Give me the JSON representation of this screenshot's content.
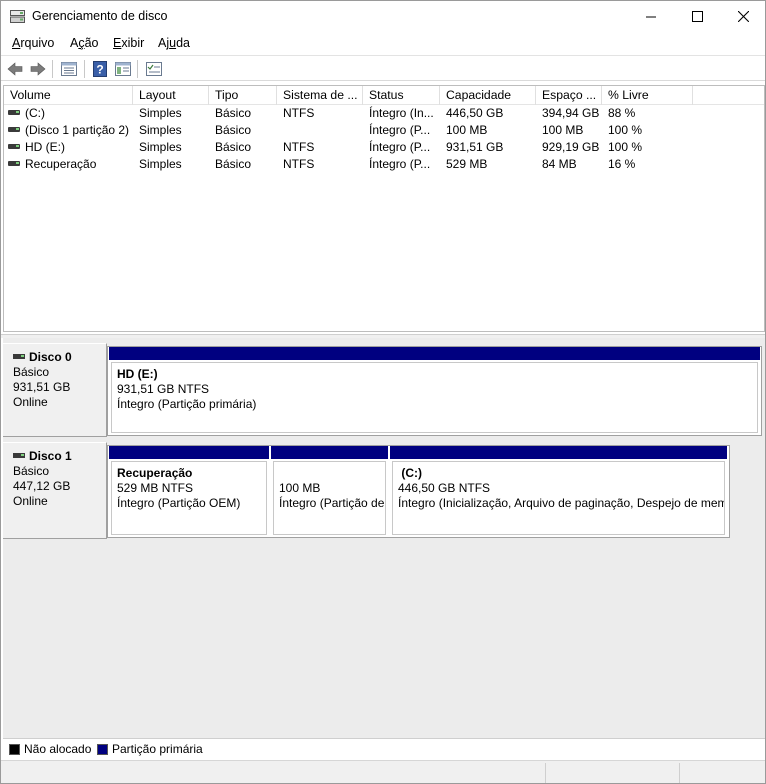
{
  "window": {
    "title": "Gerenciamento de disco",
    "controls": [
      "minimize-icon",
      "maximize-icon",
      "close-icon"
    ]
  },
  "menu": [
    {
      "label_pre": "",
      "accel": "A",
      "label_post": "rquivo"
    },
    {
      "label_pre": "A",
      "accel": "ç",
      "label_post": "ão"
    },
    {
      "label_pre": "",
      "accel": "E",
      "label_post": "xibir"
    },
    {
      "label_pre": "Aj",
      "accel": "u",
      "label_post": "da"
    }
  ],
  "toolbar": {
    "buttons": [
      "back-arrow-icon",
      "forward-arrow-icon",
      "list-view-icon",
      "help-icon",
      "console-tree-icon",
      "properties-icon"
    ]
  },
  "volume_list": {
    "columns": [
      "Volume",
      "Layout",
      "Tipo",
      "Sistema de ...",
      "Status",
      "Capacidade",
      "Espaço ...",
      "% Livre"
    ],
    "rows": [
      [
        "(C:)",
        "Simples",
        "Básico",
        "NTFS",
        "Íntegro (In...",
        "446,50 GB",
        "394,94 GB",
        "88 %"
      ],
      [
        "(Disco 1 partição 2)",
        "Simples",
        "Básico",
        "",
        "Íntegro (P...",
        "100 MB",
        "100 MB",
        "100 %"
      ],
      [
        "HD (E:)",
        "Simples",
        "Básico",
        "NTFS",
        "Íntegro (P...",
        "931,51 GB",
        "929,19 GB",
        "100 %"
      ],
      [
        "Recuperação",
        "Simples",
        "Básico",
        "NTFS",
        "Íntegro (P...",
        "529 MB",
        "84 MB",
        "16 %"
      ]
    ]
  },
  "disks": [
    {
      "name": "Disco 0",
      "type": "Básico",
      "size": "931,51 GB",
      "state": "Online",
      "partitions": [
        {
          "name": "HD  (E:)",
          "size_fs": "931,51 GB NTFS",
          "status": "Íntegro (Partição primária)"
        }
      ]
    },
    {
      "name": "Disco 1",
      "type": "Básico",
      "size": "447,12 GB",
      "state": "Online",
      "partitions": [
        {
          "name": "Recuperação",
          "size_fs": "529 MB NTFS",
          "status": "Íntegro (Partição OEM)"
        },
        {
          "name": "",
          "size_fs": "100 MB",
          "status": "Íntegro (Partição de"
        },
        {
          "name": " (C:)",
          "size_fs": "446,50 GB NTFS",
          "status": "Íntegro (Inicialização, Arquivo de paginação, Despejo de mem"
        }
      ]
    }
  ],
  "legend": [
    {
      "label": "Não alocado",
      "color": "#000000"
    },
    {
      "label": "Partição primária",
      "color": "#000080"
    }
  ],
  "colors": {
    "partition_bar": "#000080",
    "pane_background": "#ececec"
  }
}
